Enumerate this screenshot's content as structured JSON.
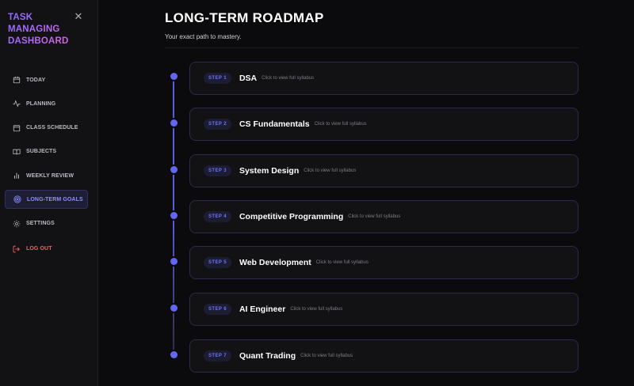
{
  "sidebar": {
    "brand": "TASK MANAGING DASHBOARD",
    "close_icon": "close-icon",
    "items": [
      {
        "label": "TODAY",
        "icon": "calendar-icon"
      },
      {
        "label": "PLANNING",
        "icon": "activity-icon"
      },
      {
        "label": "CLASS SCHEDULE",
        "icon": "schedule-icon"
      },
      {
        "label": "SUBJECTS",
        "icon": "book-icon"
      },
      {
        "label": "WEEKLY REVIEW",
        "icon": "bar-chart-icon"
      },
      {
        "label": "LONG-TERM GOALS",
        "icon": "target-icon",
        "active": true
      },
      {
        "label": "SETTINGS",
        "icon": "gear-icon"
      }
    ],
    "logout": {
      "label": "LOG OUT",
      "icon": "logout-icon"
    }
  },
  "main": {
    "title": "LONG-TERM ROADMAP",
    "subtitle": "Your exact path to mastery.",
    "steps": [
      {
        "badge": "STEP 1",
        "name": "DSA",
        "hint": "Click to view full syllabus"
      },
      {
        "badge": "STEP 2",
        "name": "CS Fundamentals",
        "hint": "Click to view full syllabus"
      },
      {
        "badge": "STEP 3",
        "name": "System Design",
        "hint": "Click to view full syllabus"
      },
      {
        "badge": "STEP 4",
        "name": "Competitive Programming",
        "hint": "Click to view full syllabus"
      },
      {
        "badge": "STEP 5",
        "name": "Web Development",
        "hint": "Click to view full syllabus"
      },
      {
        "badge": "STEP 6",
        "name": "AI Engineer",
        "hint": "Click to view full syllabus"
      },
      {
        "badge": "STEP 7",
        "name": "Quant Trading",
        "hint": "Click to view full syllabus"
      }
    ]
  },
  "colors": {
    "accent": "#6366f1",
    "logout": "#ff5a66",
    "background": "#0b0b0d",
    "card": "#121215"
  }
}
